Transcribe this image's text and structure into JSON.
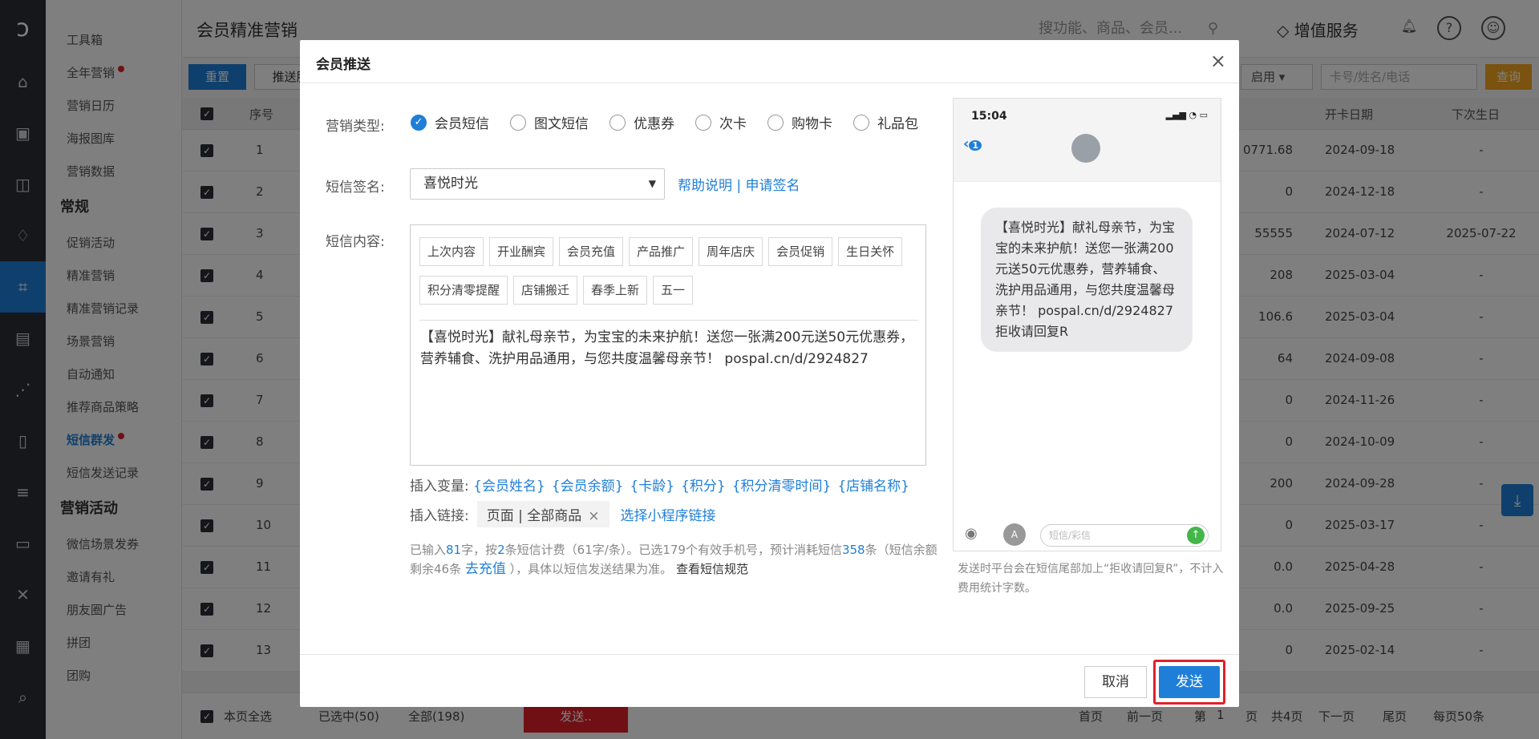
{
  "app": {
    "page_title": "会员精准营销",
    "search_placeholder": "搜功能、商品、会员...",
    "value_added": "增值服务"
  },
  "sidebar": {
    "items_top": [
      "工具箱",
      "全年营销",
      "营销日历",
      "海报图库",
      "营销数据"
    ],
    "group1": "常规",
    "items_mid": [
      "促销活动",
      "精准营销",
      "精准营销记录",
      "场景营销",
      "自动通知",
      "推荐商品策略",
      "短信群发",
      "短信发送记录"
    ],
    "group2": "营销活动",
    "items_bottom": [
      "微信场景发券",
      "邀请有礼",
      "朋友圈广告",
      "拼团",
      "团购"
    ]
  },
  "toolbar": {
    "reset": "重置",
    "push": "推送服",
    "status_select": "启用",
    "card_placeholder": "卡号/姓名/电话",
    "query": "查询"
  },
  "table": {
    "headers": {
      "index": "序号",
      "open_date": "开卡日期",
      "next_birthday": "下次生日"
    },
    "rows": [
      {
        "no": "1",
        "amount": "0771.68",
        "open": "2024-09-18",
        "bday": "-"
      },
      {
        "no": "2",
        "amount": "0",
        "open": "2024-12-18",
        "bday": "-"
      },
      {
        "no": "3",
        "amount": "55555",
        "open": "2024-07-12",
        "bday": "2025-07-22"
      },
      {
        "no": "4",
        "amount": "208",
        "open": "2025-03-04",
        "bday": "-"
      },
      {
        "no": "5",
        "amount": "106.6",
        "open": "2025-03-04",
        "bday": "-"
      },
      {
        "no": "6",
        "amount": "64",
        "open": "2024-09-08",
        "bday": "-"
      },
      {
        "no": "7",
        "amount": "0",
        "open": "2024-11-26",
        "bday": "-"
      },
      {
        "no": "8",
        "amount": "0",
        "open": "2024-10-09",
        "bday": "-"
      },
      {
        "no": "9",
        "amount": "200",
        "open": "2024-09-28",
        "bday": "-"
      },
      {
        "no": "10",
        "amount": "0",
        "open": "2025-03-17",
        "bday": "-"
      },
      {
        "no": "11",
        "amount": "0.0",
        "open": "2025-04-28",
        "bday": "-"
      },
      {
        "no": "12",
        "amount": "0.0",
        "open": "2025-09-25",
        "bday": "-"
      },
      {
        "no": "13",
        "amount": "0",
        "open": "2025-02-14",
        "bday": "-"
      }
    ]
  },
  "footer": {
    "select_page": "本页全选",
    "selected": "已选中(50)",
    "all": "全部(198)",
    "send": "发送..",
    "first": "首页",
    "prev": "前一页",
    "page_prefix": "第",
    "page_no": "1",
    "page_suffix": "页",
    "total": "共4页",
    "next": "下一页",
    "last": "尾页",
    "per_page": "每页50条"
  },
  "modal": {
    "title": "会员推送",
    "type_label": "营销类型:",
    "types": [
      {
        "label": "会员短信",
        "checked": true
      },
      {
        "label": "图文短信",
        "checked": false
      },
      {
        "label": "优惠券",
        "checked": false
      },
      {
        "label": "次卡",
        "checked": false
      },
      {
        "label": "购物卡",
        "checked": false
      },
      {
        "label": "礼品包",
        "checked": false
      }
    ],
    "sig_label": "短信签名:",
    "sig_value": "喜悦时光",
    "sig_help": "帮助说明 | 申请签名",
    "content_label": "短信内容:",
    "tags": [
      "上次内容",
      "开业酬宾",
      "会员充值",
      "产品推广",
      "周年店庆",
      "会员促销",
      "生日关怀",
      "积分清零提醒",
      "店铺搬迁",
      "春季上新",
      "五一"
    ],
    "content": "【喜悦时光】献礼母亲节，为宝宝的未来护航！送您一张满200元送50元优惠券，营养辅食、洗护用品通用，与您共度温馨母亲节！ pospal.cn/d/2924827",
    "insert_var_label": "插入变量:",
    "vars": [
      "{会员姓名}",
      "{会员余额}",
      "{卡龄}",
      "{积分}",
      "{积分清零时间}",
      "{店铺名称}"
    ],
    "insert_link_label": "插入链接:",
    "link_value": "页面 | 全部商品",
    "mini_link": "选择小程序链接",
    "count": {
      "p1": "已输入",
      "chars": "81",
      "p2": "字，按",
      "segments": "2",
      "p3": "条短信计费（61字/条）。已选179个有效手机号，预计消耗短信",
      "total": "358",
      "p4": "条（短信余额剩余46条",
      "recharge": "去充值",
      "p5": "），具体以短信发送结果为准。",
      "rules": "查看短信规范"
    },
    "phone": {
      "time": "15:04",
      "back_badge": "1",
      "bubble": "【喜悦时光】献礼母亲节，为宝宝的未来护航！送您一张满200元送50元优惠券，营养辅食、洗护用品通用，与您共度温馨母亲节！ pospal.cn/d/2924827 拒收请回复R",
      "input_placeholder": "短信/彩信"
    },
    "phone_note": "发送时平台会在短信尾部加上“拒收请回复R”，不计入费用统计字数。",
    "cancel": "取消",
    "send": "发送"
  }
}
